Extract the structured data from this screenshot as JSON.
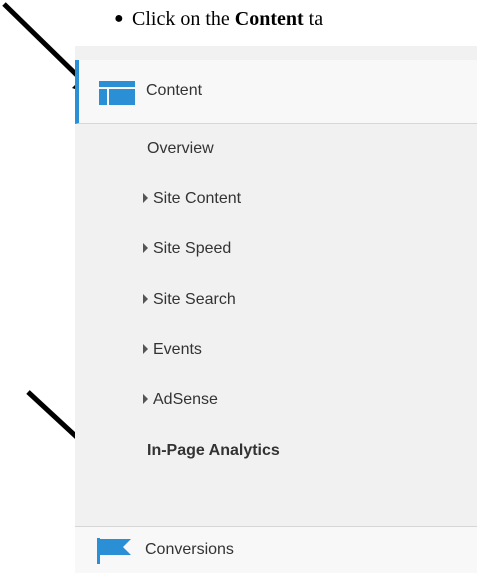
{
  "instruction": {
    "prefix": "Click on the ",
    "emphasis": "Content",
    "suffix": " ta"
  },
  "nav": {
    "content": {
      "label": "Content",
      "icon": "content-layout-icon",
      "accent": "#2b8fd6"
    },
    "items": [
      {
        "label": "Overview",
        "expandable": false
      },
      {
        "label": "Site Content",
        "expandable": true
      },
      {
        "label": "Site Speed",
        "expandable": true
      },
      {
        "label": "Site Search",
        "expandable": true
      },
      {
        "label": "Events",
        "expandable": true
      },
      {
        "label": "AdSense",
        "expandable": true
      },
      {
        "label": "In-Page Analytics",
        "expandable": false,
        "bold": true
      }
    ],
    "conversions": {
      "label": "Conversions",
      "icon": "flag-icon"
    }
  }
}
